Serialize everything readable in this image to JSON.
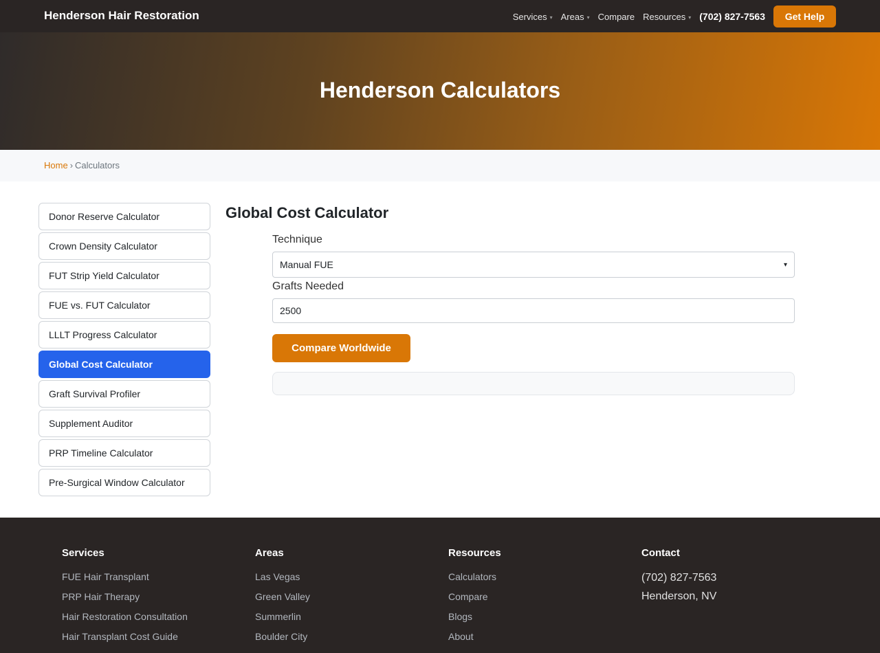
{
  "header": {
    "brand": "Henderson Hair Restoration",
    "nav": [
      {
        "label": "Services",
        "dropdown": true
      },
      {
        "label": "Areas",
        "dropdown": true
      },
      {
        "label": "Compare",
        "dropdown": false
      },
      {
        "label": "Resources",
        "dropdown": true
      }
    ],
    "phone": "(702) 827-7563",
    "cta": "Get Help",
    "caret_glyph": "▾"
  },
  "hero": {
    "title": "Henderson Calculators"
  },
  "breadcrumb": {
    "home": "Home",
    "separator": "›",
    "current": "Calculators"
  },
  "sidebar": {
    "items": [
      "Donor Reserve Calculator",
      "Crown Density Calculator",
      "FUT Strip Yield Calculator",
      "FUE vs. FUT Calculator",
      "LLLT Progress Calculator",
      "Global Cost Calculator",
      "Graft Survival Profiler",
      "Supplement Auditor",
      "PRP Timeline Calculator",
      "Pre-Surgical Window Calculator"
    ],
    "active_index": 5
  },
  "calculator": {
    "title": "Global Cost Calculator",
    "technique_label": "Technique",
    "technique_value": "Manual FUE",
    "grafts_label": "Grafts Needed",
    "grafts_value": "2500",
    "button": "Compare Worldwide"
  },
  "footer": {
    "services": {
      "heading": "Services",
      "links": [
        "FUE Hair Transplant",
        "PRP Hair Therapy",
        "Hair Restoration Consultation",
        "Hair Transplant Cost Guide"
      ]
    },
    "areas": {
      "heading": "Areas",
      "links": [
        "Las Vegas",
        "Green Valley",
        "Summerlin",
        "Boulder City"
      ]
    },
    "resources": {
      "heading": "Resources",
      "links": [
        "Calculators",
        "Compare",
        "Blogs",
        "About"
      ]
    },
    "contact": {
      "heading": "Contact",
      "phone": "(702) 827-7563",
      "location": "Henderson, NV"
    }
  },
  "colors": {
    "accent": "#d97706",
    "active": "#2563eb",
    "dark": "#2a2524"
  }
}
